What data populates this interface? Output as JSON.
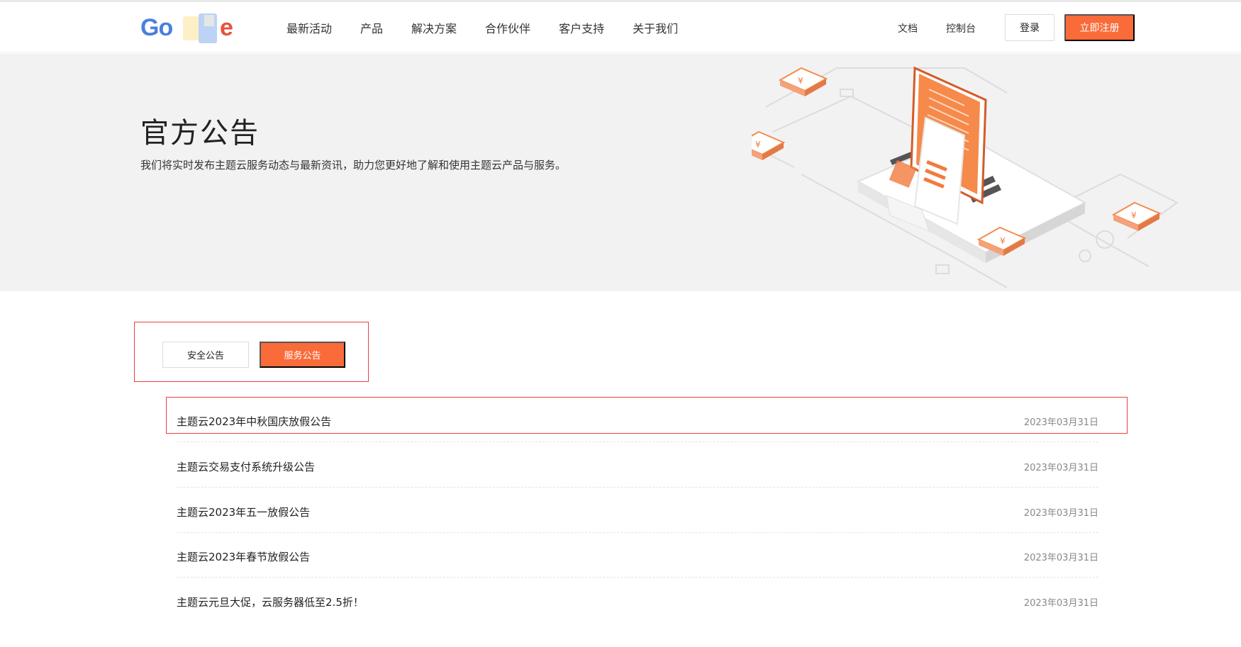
{
  "header": {
    "logo_letters": [
      "Go",
      "e"
    ],
    "nav": [
      "最新活动",
      "产品",
      "解决方案",
      "合作伙伴",
      "客户支持",
      "关于我们"
    ],
    "doc_link": "文档",
    "console_link": "控制台",
    "login_label": "登录",
    "register_label": "立即注册"
  },
  "banner": {
    "title": "官方公告",
    "description": "我们将实时发布主题云服务动态与最新资讯，助力您更好地了解和使用主题云产品与服务。"
  },
  "tabs": {
    "security_label": "安全公告",
    "service_label": "服务公告",
    "active": "服务公告"
  },
  "notices": [
    {
      "title": "主题云2023年中秋国庆放假公告",
      "date": "2023年03月31日"
    },
    {
      "title": "主题云交易支付系统升级公告",
      "date": "2023年03月31日"
    },
    {
      "title": "主题云2023年五一放假公告",
      "date": "2023年03月31日"
    },
    {
      "title": "主题云2023年春节放假公告",
      "date": "2023年03月31日"
    },
    {
      "title": "主题云元旦大促，云服务器低至2.5折！",
      "date": "2023年03月31日"
    }
  ],
  "colors": {
    "accent": "#fa6b3a",
    "highlight_border": "#ee3f3f",
    "banner_bg": "#f2f2f2"
  },
  "icons": [
    "logo-icon",
    "invoice-illustration-icon"
  ]
}
